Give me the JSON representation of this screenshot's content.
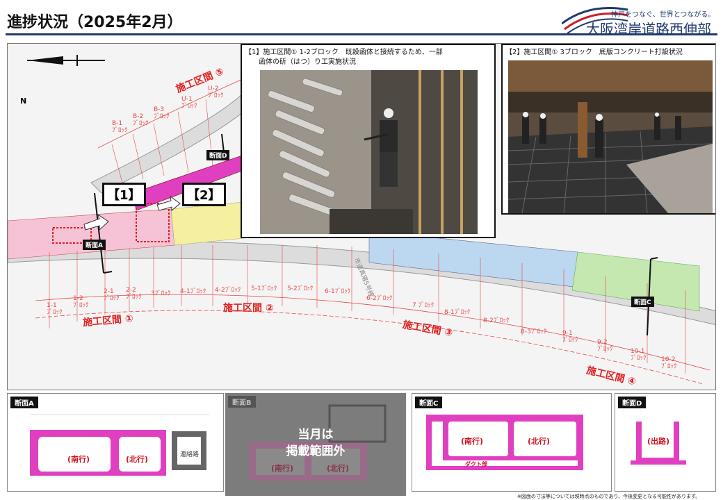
{
  "header": {
    "title": "進捗状況（2025年2月）",
    "tagline": "神戸をつなぐ、世界とつながる。",
    "org_name": "大阪湾岸道路西伸部"
  },
  "map": {
    "north_label": "N",
    "section_labels": [
      "施工区間 ①",
      "施工区間 ②",
      "施工区間 ③",
      "施工区間 ④",
      "施工区間 ⑤"
    ],
    "road_name": "市道真陽5号線",
    "blocks_upper": [
      "B-1\nﾌﾞﾛｯｸ",
      "B-2\nﾌﾞﾛｯｸ",
      "B-3\nﾌﾞﾛｯｸ",
      "U-1\nﾌﾞﾛｯｸ",
      "U-2\nﾌﾞﾛｯｸ"
    ],
    "blocks_lower": [
      "1-1\nﾌﾞﾛｯｸ",
      "1-2\nﾌﾞﾛｯｸ",
      "2-1\nﾌﾞﾛｯｸ",
      "2-2\nﾌﾞﾛｯｸ",
      "3ﾌﾞﾛｯｸ",
      "4-1ﾌﾞﾛｯｸ",
      "4-2ﾌﾞﾛｯｸ",
      "5-1ﾌﾞﾛｯｸ",
      "5-2ﾌﾞﾛｯｸ",
      "6-1ﾌﾞﾛｯｸ",
      "6-2ﾌﾞﾛｯｸ",
      "7 ﾌﾞﾛｯｸ",
      "8-1ﾌﾞﾛｯｸ",
      "8-2ﾌﾞﾛｯｸ",
      "8-3ﾌﾞﾛｯｸ",
      "9-1\nﾌﾞﾛｯｸ",
      "9-2\nﾌﾞﾛｯｸ",
      "10-1\nﾌﾞﾛｯｸ",
      "10-2\nﾌﾞﾛｯｸ"
    ],
    "marker_1": "【1】",
    "marker_2": "【2】",
    "cut_a": "断面A",
    "cut_c": "断面C",
    "cut_d": "断面D"
  },
  "photos": {
    "photo1_caption_1": "【1】施工区間① 1-2ブロック　既設函体と接続するため、一部",
    "photo1_caption_2": "函体の斫（はつ）り工実施状況",
    "photo2_caption": "【2】施工区間① 3ブロック　底版コンクリート打設状況"
  },
  "sections": {
    "a_label": "断面A",
    "b_label": "断面B",
    "c_label": "断面C",
    "d_label": "断面D",
    "south": "(南行)",
    "north": "(北行)",
    "exit": "(出路)",
    "connector": "連絡路",
    "duct": "ダクト部",
    "outside_1": "当月は",
    "outside_2": "掲載範囲外"
  },
  "footnote": "※図面の寸法等については現時点のものであり、今後変更となる可能性があります。",
  "colors": {
    "pink": "#f0a0c8",
    "magenta": "#e040c0",
    "yellow": "#f5f0a0",
    "blue": "#bcd8f0",
    "green": "#c4e8b0",
    "red_line": "#e74747",
    "navy": "#1f3a6e"
  }
}
